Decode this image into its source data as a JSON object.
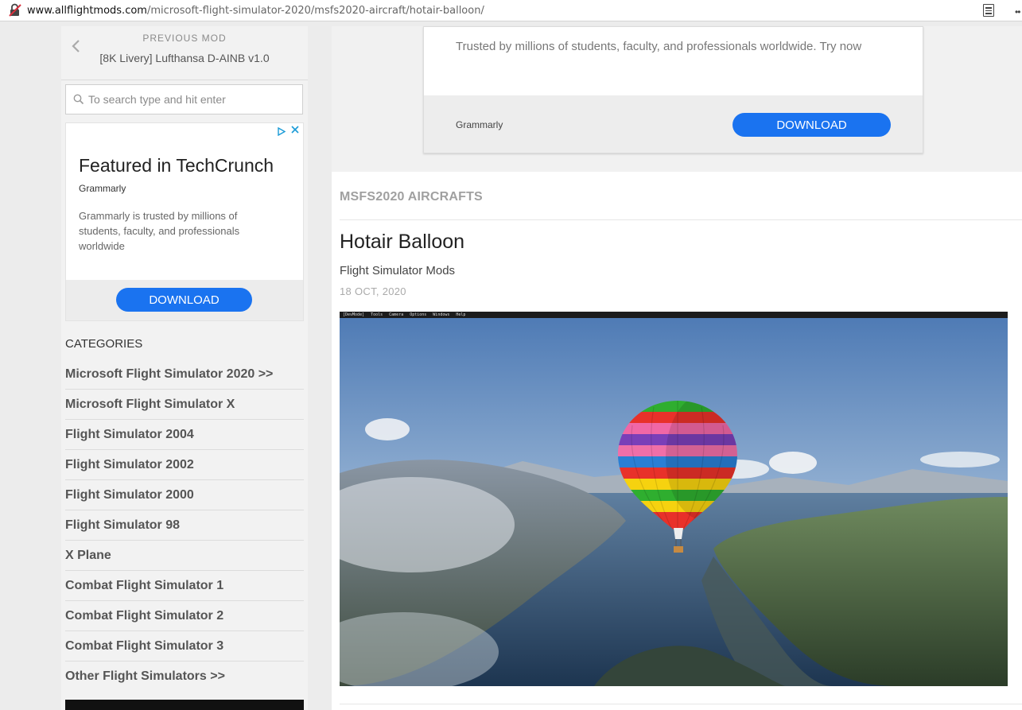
{
  "browser": {
    "url_host": "www.allflightmods.com",
    "url_path": "/microsoft-flight-simulator-2020/msfs2020-aircraft/hotair-balloon/",
    "more": "••"
  },
  "sidebar": {
    "previous_label": "PREVIOUS MOD",
    "previous_title": "[8K Livery] Lufthansa D-AINB v1.0",
    "search_placeholder": "To search type and hit enter",
    "ad": {
      "title": "Featured in TechCrunch",
      "brand": "Grammarly",
      "body": "Grammarly is trusted by millions of students, faculty, and professionals worldwide",
      "button": "DOWNLOAD"
    },
    "categories_heading": "CATEGORIES",
    "categories": [
      "Microsoft Flight Simulator 2020 >>",
      "Microsoft Flight Simulator X",
      "Flight Simulator 2004",
      "Flight Simulator 2002",
      "Flight Simulator 2000",
      "Flight Simulator 98",
      "X Plane",
      "Combat Flight Simulator 1",
      "Combat Flight Simulator 2",
      "Combat Flight Simulator 3",
      "Other Flight Simulators >>"
    ]
  },
  "main": {
    "top_ad": {
      "text": "Trusted by millions of students, faculty, and professionals worldwide. Try now",
      "brand": "Grammarly",
      "button": "DOWNLOAD"
    },
    "breadcrumb": "MSFS2020 AIRCRAFTS",
    "title": "Hotair Balloon",
    "category": "Flight Simulator Mods",
    "date": "18 OCT, 2020",
    "game_menu": [
      "[DevMode]",
      "Tools",
      "Camera",
      "Options",
      "Windows",
      "Help"
    ]
  },
  "colors": {
    "accent_button": "#1a73f0",
    "sidebar_bg": "#f2f2f2"
  },
  "balloon_stripes": [
    "#2fae2f",
    "#e8312a",
    "#f067a6",
    "#7a3fb8",
    "#f06fa8",
    "#2a7fd4",
    "#e8312a",
    "#f6d20f",
    "#2fae2f",
    "#f6d20f",
    "#e8312a"
  ]
}
